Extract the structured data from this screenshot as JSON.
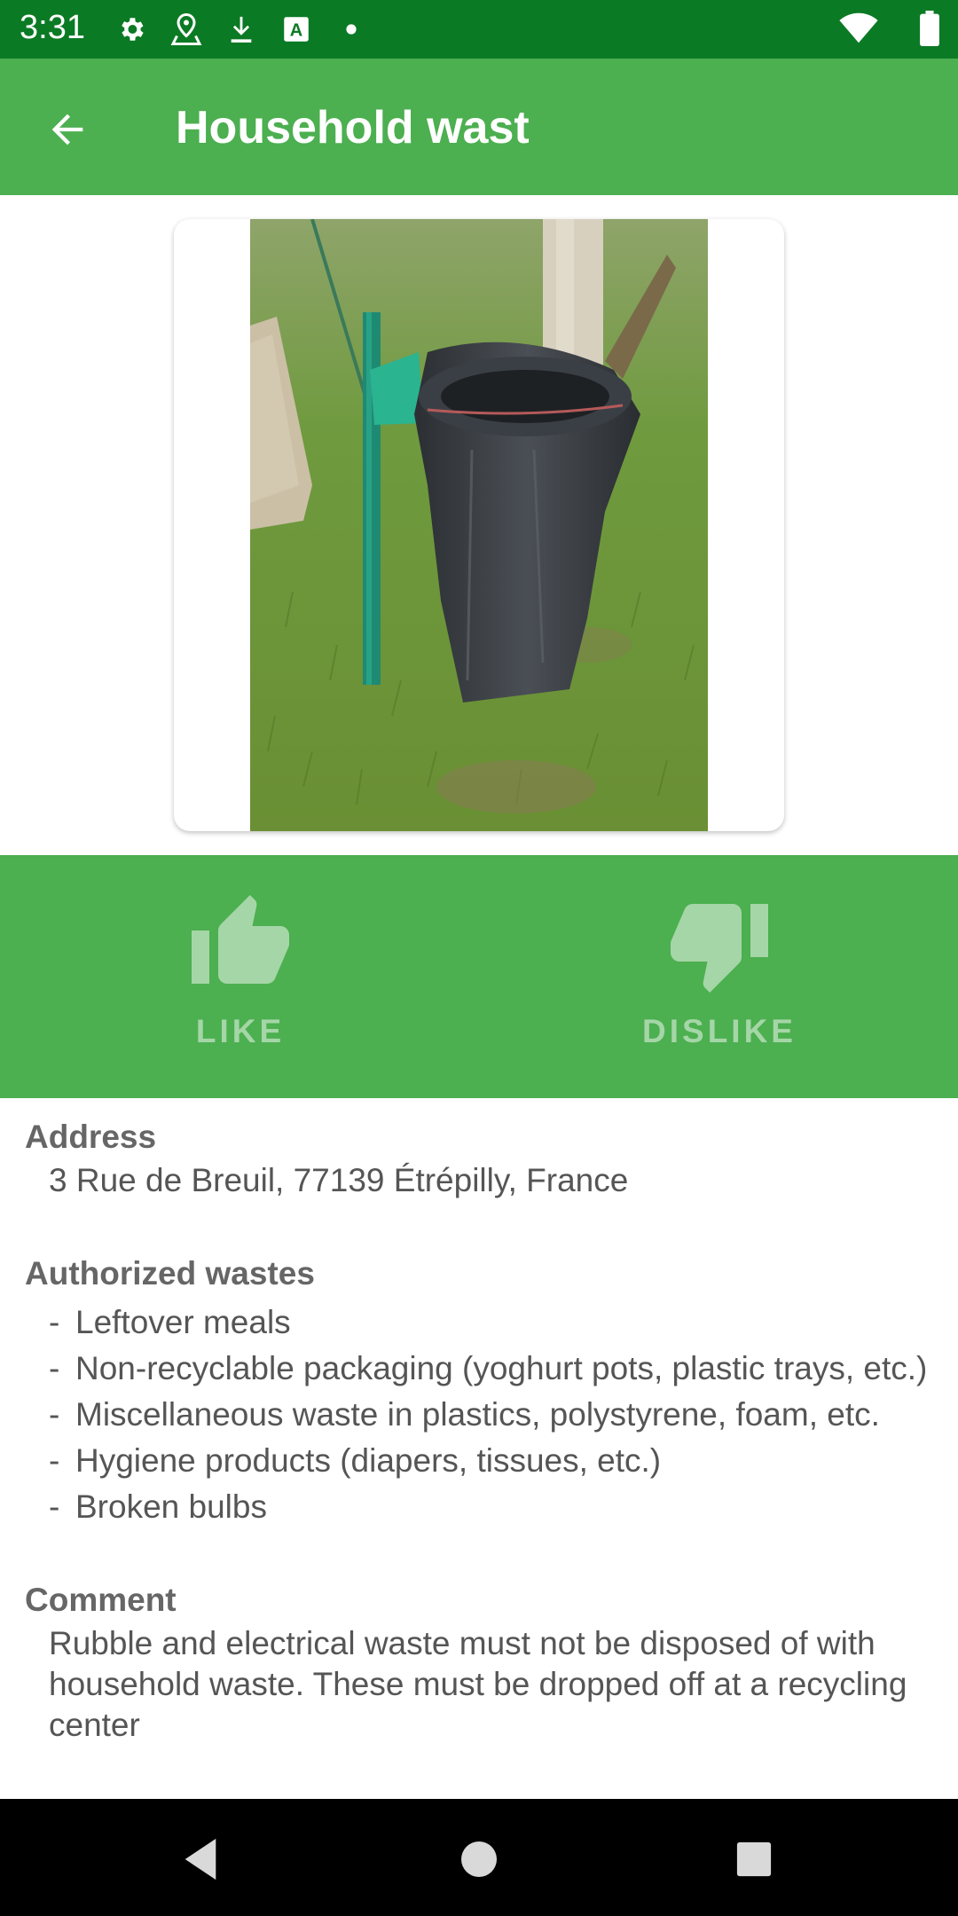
{
  "status_bar": {
    "time": "3:31",
    "left_icons": [
      "settings-icon",
      "location-icon",
      "download-icon",
      "keyboard-a-icon",
      "dot-icon"
    ],
    "right_icons": [
      "wifi-icon",
      "battery-icon"
    ],
    "color": "#0b7a24"
  },
  "app_bar": {
    "title": "Household wast",
    "back_icon": "arrow-left-icon",
    "color": "#4caf50"
  },
  "photo": {
    "alt": "photo of a trash bag hanging on a green post in grass"
  },
  "votes": {
    "like_label": "LIKE",
    "dislike_label": "DISLIKE",
    "like_icon": "thumbs-up-icon",
    "dislike_icon": "thumbs-down-icon"
  },
  "details": {
    "address_title": "Address",
    "address": "3 Rue de Breuil, 77139 Étrépilly, France",
    "wastes_title": "Authorized wastes",
    "wastes": [
      "Leftover meals",
      "Non-recyclable packaging (yoghurt pots, plastic trays, etc.)",
      "Miscellaneous waste in plastics, polystyrene, foam, etc.",
      "Hygiene products (diapers, tissues, etc.)",
      "Broken bulbs"
    ],
    "comment_title": "Comment",
    "comment": "Rubble and electrical waste must not be disposed of with household waste. These must be dropped off at a recycling center"
  },
  "nav_bar": {
    "buttons": [
      "back-triangle-icon",
      "home-circle-icon",
      "recents-square-icon"
    ]
  }
}
